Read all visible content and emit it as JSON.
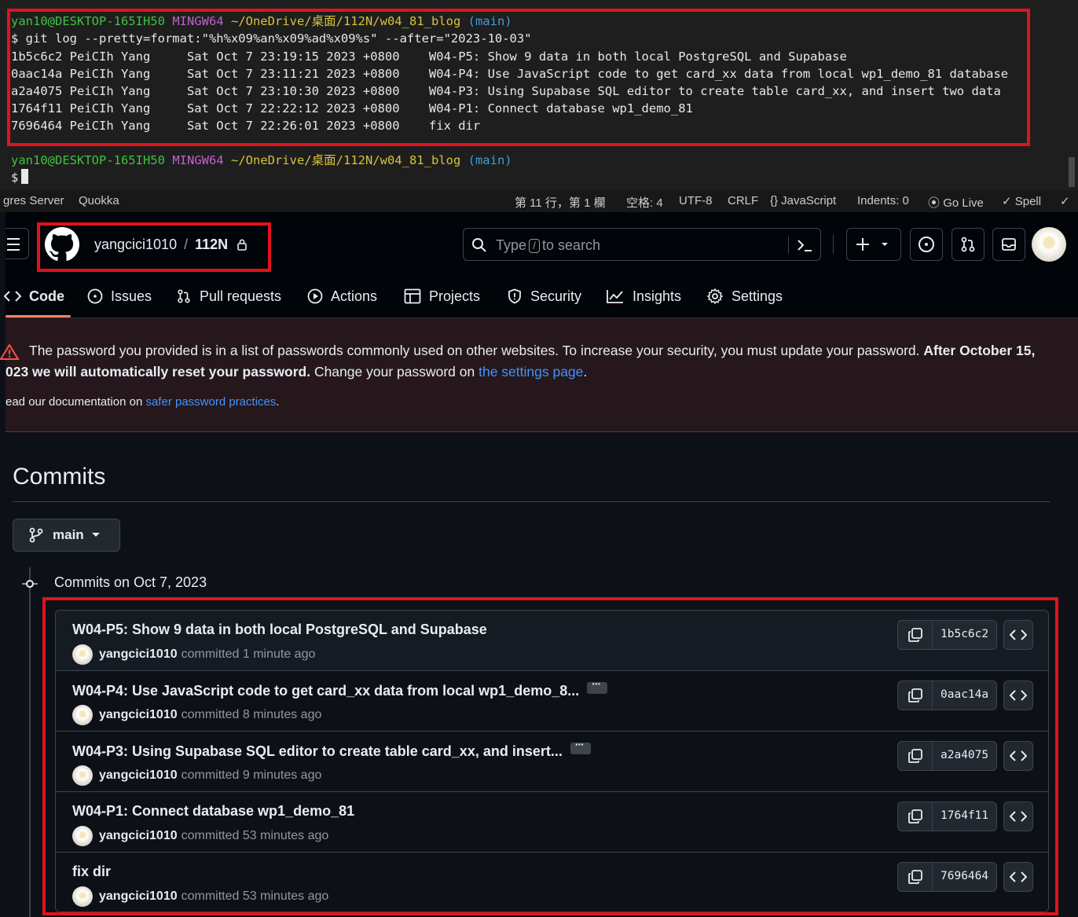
{
  "terminal": {
    "prompt1": {
      "user": "yan10@DESKTOP-165IH50",
      "env": "MINGW64",
      "path": "~/OneDrive/桌面/112N/w04_81_blog",
      "branch": "(main)"
    },
    "command": "$ git log --pretty=format:\"%h%x09%an%x09%ad%x09%s\" --after=\"2023-10-03\"",
    "log_lines": [
      "1b5c6c2 PeiCIh Yang     Sat Oct 7 23:19:15 2023 +0800    W04-P5: Show 9 data in both local PostgreSQL and Supabase",
      "0aac14a PeiCIh Yang     Sat Oct 7 23:11:21 2023 +0800    W04-P4: Use JavaScript code to get card_xx data from local wp1_demo_81 database",
      "a2a4075 PeiCIh Yang     Sat Oct 7 23:10:30 2023 +0800    W04-P3: Using Supabase SQL editor to create table card_xx, and insert two data",
      "1764f11 PeiCIh Yang     Sat Oct 7 22:22:12 2023 +0800    W04-P1: Connect database wp1_demo_81",
      "7696464 PeiCIh Yang     Sat Oct 7 22:26:01 2023 +0800    fix dir"
    ],
    "prompt2": {
      "user": "yan10@DESKTOP-165IH50",
      "env": "MINGW64",
      "path": "~/OneDrive/桌面/112N/w04_81_blog",
      "branch": "(main)"
    },
    "prompt_symbol": "$"
  },
  "statusbar": {
    "left": [
      "gres Server",
      "Quokka"
    ],
    "position": "第 11 行，第 1 欄",
    "spaces": "空格: 4",
    "encoding": "UTF-8",
    "eol": "CRLF",
    "language": "{} JavaScript",
    "indents": "Indents: 0",
    "golive": "Go Live",
    "spell": "✓ Spell",
    "check": "✓"
  },
  "github": {
    "owner": "yangcici1010",
    "separator": "/",
    "repo": "112N",
    "search_prefix": "Type",
    "search_key": "/",
    "search_suffix": "to search",
    "tabs": [
      "Code",
      "Issues",
      "Pull requests",
      "Actions",
      "Projects",
      "Security",
      "Insights",
      "Settings"
    ]
  },
  "warning": {
    "line1_text": "The password you provided is in a list of passwords commonly used on other websites. To increase your security, you must update your password. ",
    "line1_bold": "After October 15,",
    "line2_bold": "023 we will automatically reset your password.",
    "line2_text": " Change your password on ",
    "line2_link": "the settings page",
    "line2_end": ".",
    "line3_text": "ead our documentation on ",
    "line3_link": "safer password practices",
    "line3_end": "."
  },
  "commits": {
    "title": "Commits",
    "branch": "main",
    "group_label": "Commits on Oct 7, 2023",
    "items": [
      {
        "message": "W04-P5: Show 9 data in both local PostgreSQL and Supabase",
        "author": "yangcici1010",
        "time": "committed 1 minute ago",
        "sha": "1b5c6c2",
        "truncated": false
      },
      {
        "message": "W04-P4: Use JavaScript code to get card_xx data from local wp1_demo_8...",
        "author": "yangcici1010",
        "time": "committed 8 minutes ago",
        "sha": "0aac14a",
        "truncated": true
      },
      {
        "message": "W04-P3: Using Supabase SQL editor to create table card_xx, and insert...",
        "author": "yangcici1010",
        "time": "committed 9 minutes ago",
        "sha": "a2a4075",
        "truncated": true
      },
      {
        "message": "W04-P1: Connect database wp1_demo_81",
        "author": "yangcici1010",
        "time": "committed 53 minutes ago",
        "sha": "1764f11",
        "truncated": false
      },
      {
        "message": "fix dir",
        "author": "yangcici1010",
        "time": "committed 53 minutes ago",
        "sha": "7696464",
        "truncated": false
      }
    ]
  },
  "colors": {
    "highlight": "#e0131b",
    "terminal_bg": "#1e1e1e",
    "github_bg": "#0d1117",
    "link": "#4493f8",
    "tab_underline": "#f78166"
  }
}
